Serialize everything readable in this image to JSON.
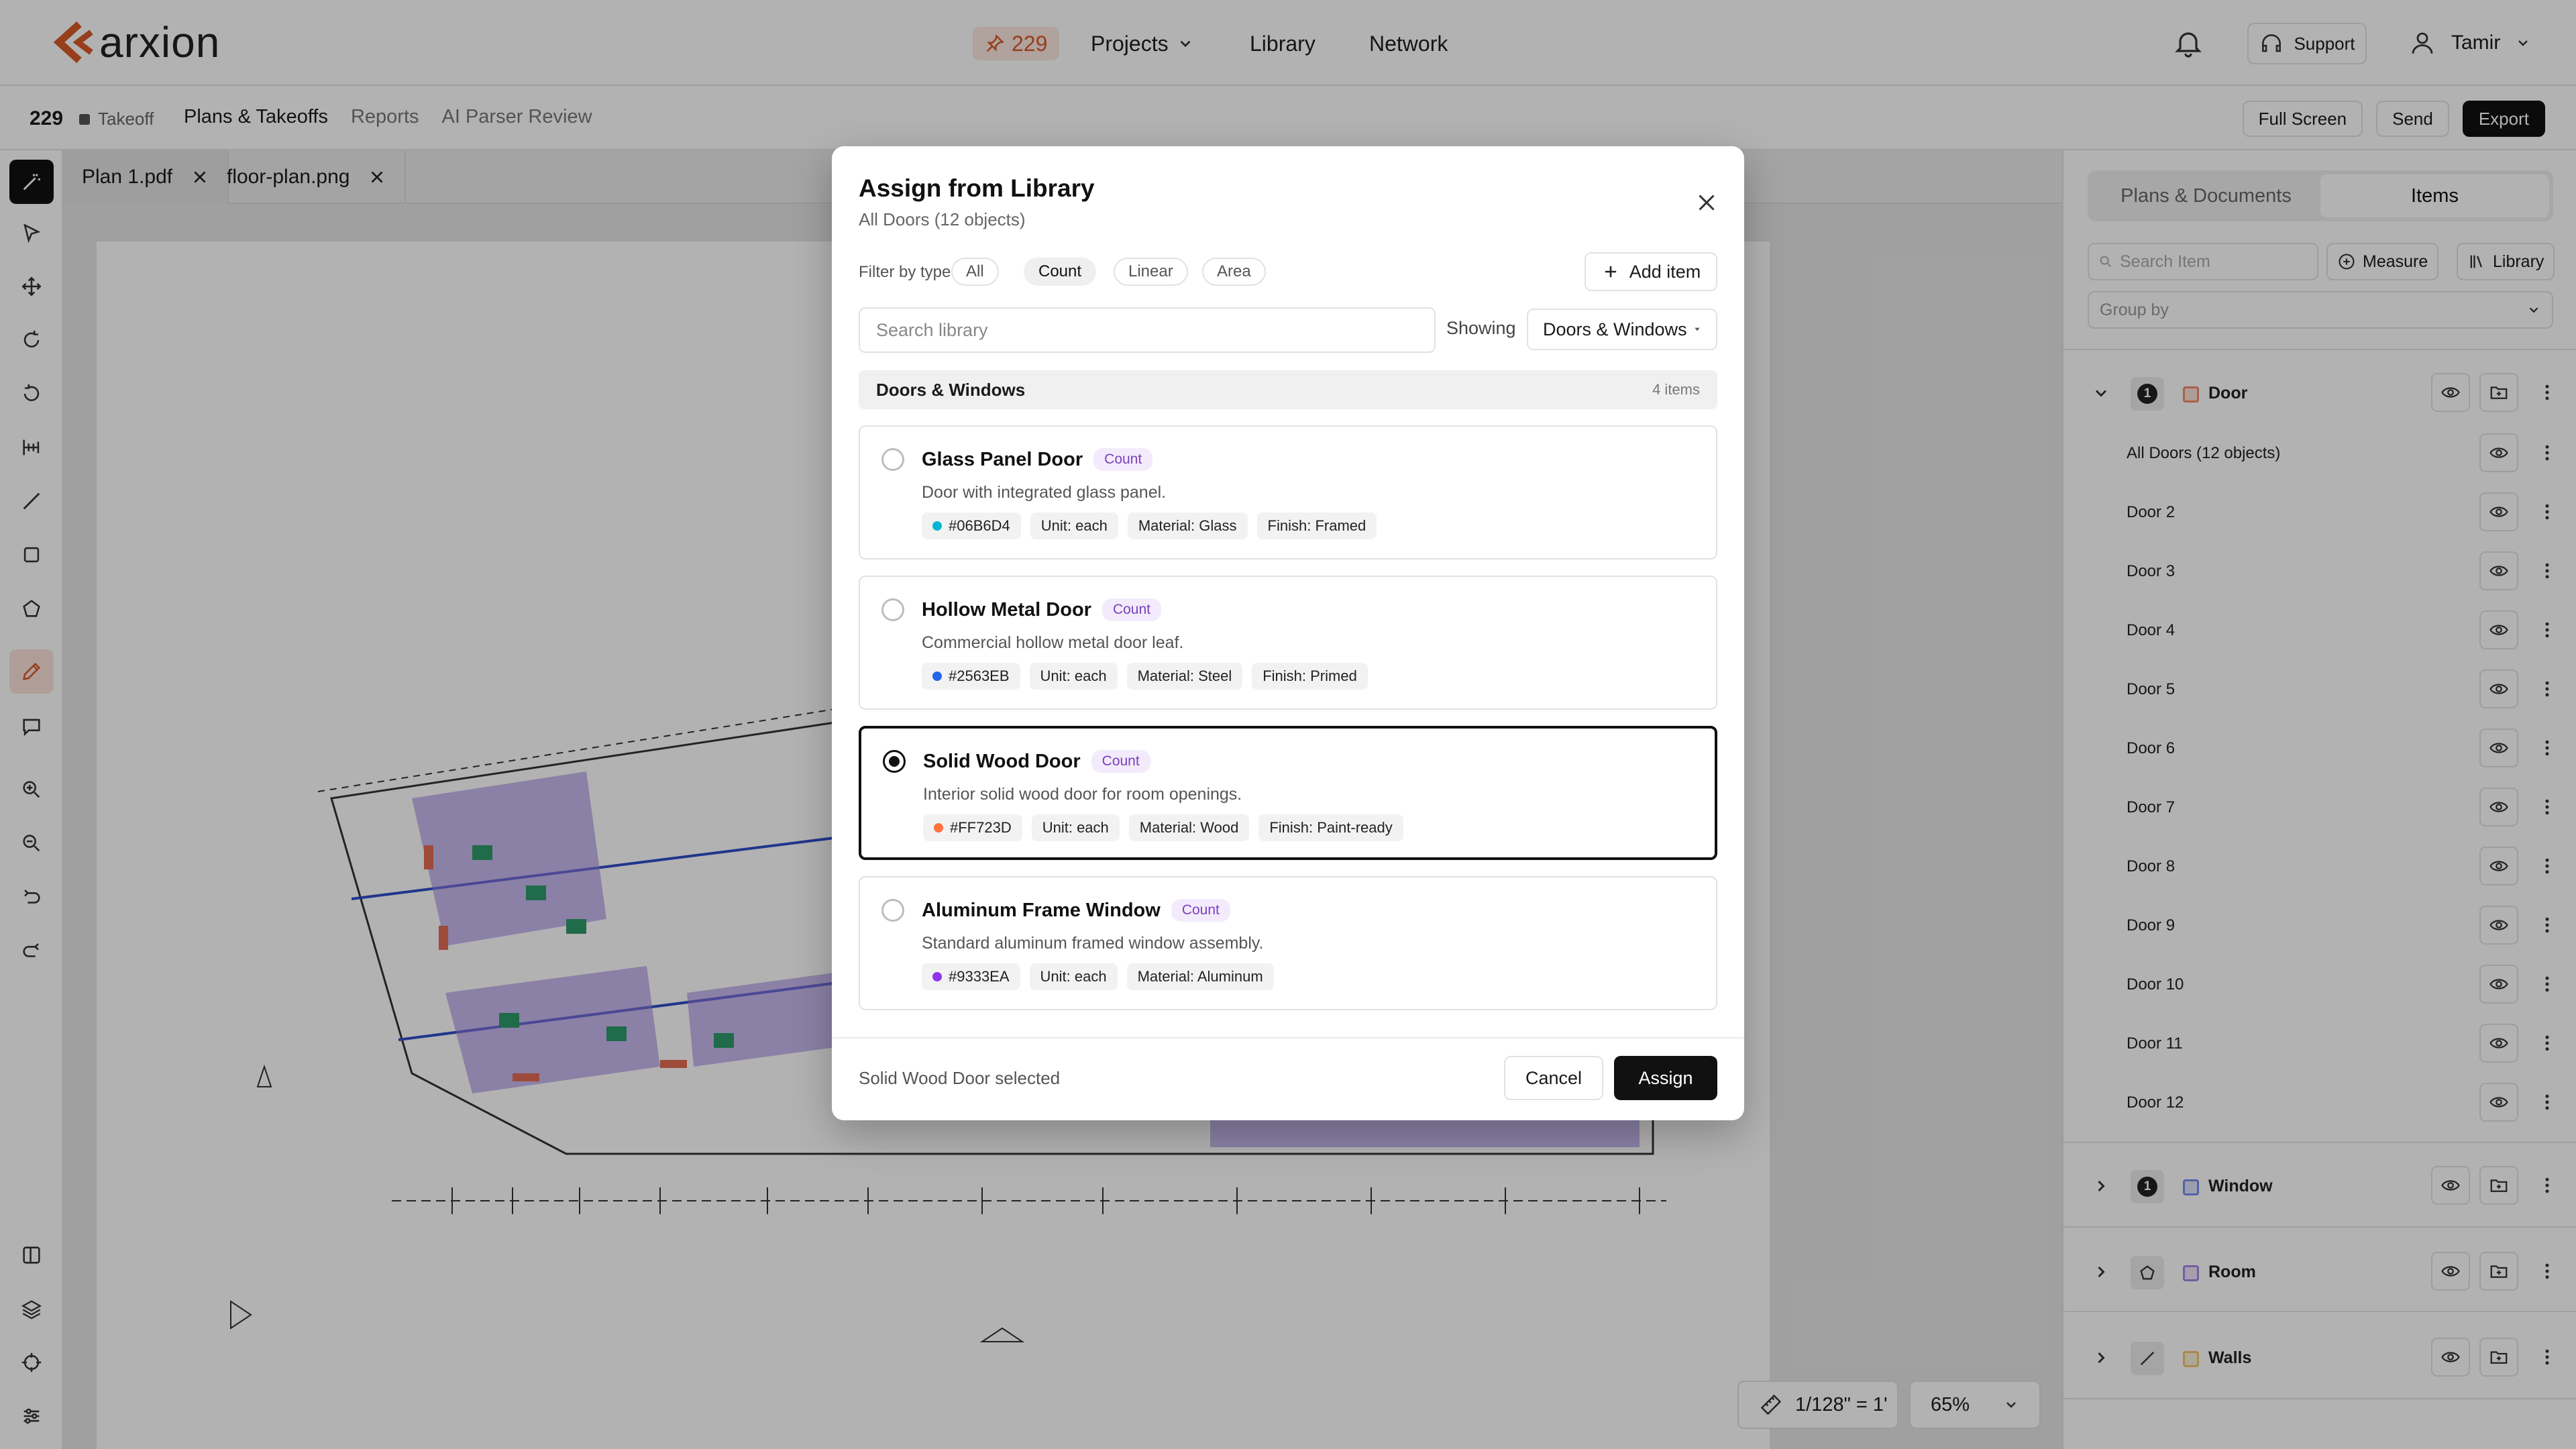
{
  "app": {
    "brand": "arxion",
    "project_badge": "229",
    "accent": "#D85A2A"
  },
  "nav": {
    "projects": "Projects",
    "library": "Library",
    "network": "Network",
    "support": "Support",
    "user": "Tamir"
  },
  "subheader": {
    "project_id": "229",
    "status": "Takeoff",
    "tabs": [
      "Plans & Takeoffs",
      "Reports",
      "AI Parser Review"
    ],
    "actions": {
      "fullscreen": "Full Screen",
      "send": "Send",
      "export": "Export"
    }
  },
  "files": {
    "tabs": [
      "Plan 1.pdf",
      "floor-plan.png"
    ]
  },
  "canvas": {
    "scale": "1/128\" = 1'",
    "zoom": "65%"
  },
  "right_panel": {
    "tabs": [
      "Plans & Documents",
      "Items"
    ],
    "search_placeholder": "Search Item",
    "measure": "Measure",
    "library": "Library",
    "group_by": "Group by",
    "door": {
      "count": "1",
      "label": "Door",
      "color": "#F28C6B",
      "items": [
        "All Doors (12 objects)",
        "Door 2",
        "Door 3",
        "Door 4",
        "Door 5",
        "Door 6",
        "Door 7",
        "Door 8",
        "Door 9",
        "Door 10",
        "Door 11",
        "Door 12"
      ]
    },
    "window": {
      "count": "1",
      "label": "Window",
      "color": "#7A8CF0"
    },
    "room": {
      "label": "Room",
      "color": "#A884E6"
    },
    "walls": {
      "label": "Walls",
      "color": "#F2C46B"
    }
  },
  "modal": {
    "title": "Assign from Library",
    "subtitle": "All Doors (12 objects)",
    "filter_label": "Filter by type",
    "filters": [
      "All",
      "Count",
      "Linear",
      "Area"
    ],
    "add_item": "Add item",
    "search_placeholder": "Search library",
    "showing_label": "Showing",
    "showing_value": "Doors & Windows",
    "group": {
      "name": "Doors & Windows",
      "count": "4 items"
    },
    "cards": [
      {
        "name": "Glass Panel Door",
        "type": "Count",
        "desc": "Door with integrated glass panel.",
        "color": "#06B6D4",
        "tags": [
          "#06B6D4",
          "Unit: each",
          "Material: Glass",
          "Finish: Framed"
        ]
      },
      {
        "name": "Hollow Metal Door",
        "type": "Count",
        "desc": "Commercial hollow metal door leaf.",
        "color": "#2563EB",
        "tags": [
          "#2563EB",
          "Unit: each",
          "Material: Steel",
          "Finish: Primed"
        ]
      },
      {
        "name": "Solid Wood Door",
        "type": "Count",
        "desc": "Interior solid wood door for room openings.",
        "color": "#FF723D",
        "tags": [
          "#FF723D",
          "Unit: each",
          "Material: Wood",
          "Finish: Paint-ready"
        ]
      },
      {
        "name": "Aluminum Frame Window",
        "type": "Count",
        "desc": "Standard aluminum framed window assembly.",
        "color": "#9333EA",
        "tags": [
          "#9333EA",
          "Unit: each",
          "Material: Aluminum"
        ]
      }
    ],
    "status": "Solid Wood Door selected",
    "cancel": "Cancel",
    "assign": "Assign"
  }
}
